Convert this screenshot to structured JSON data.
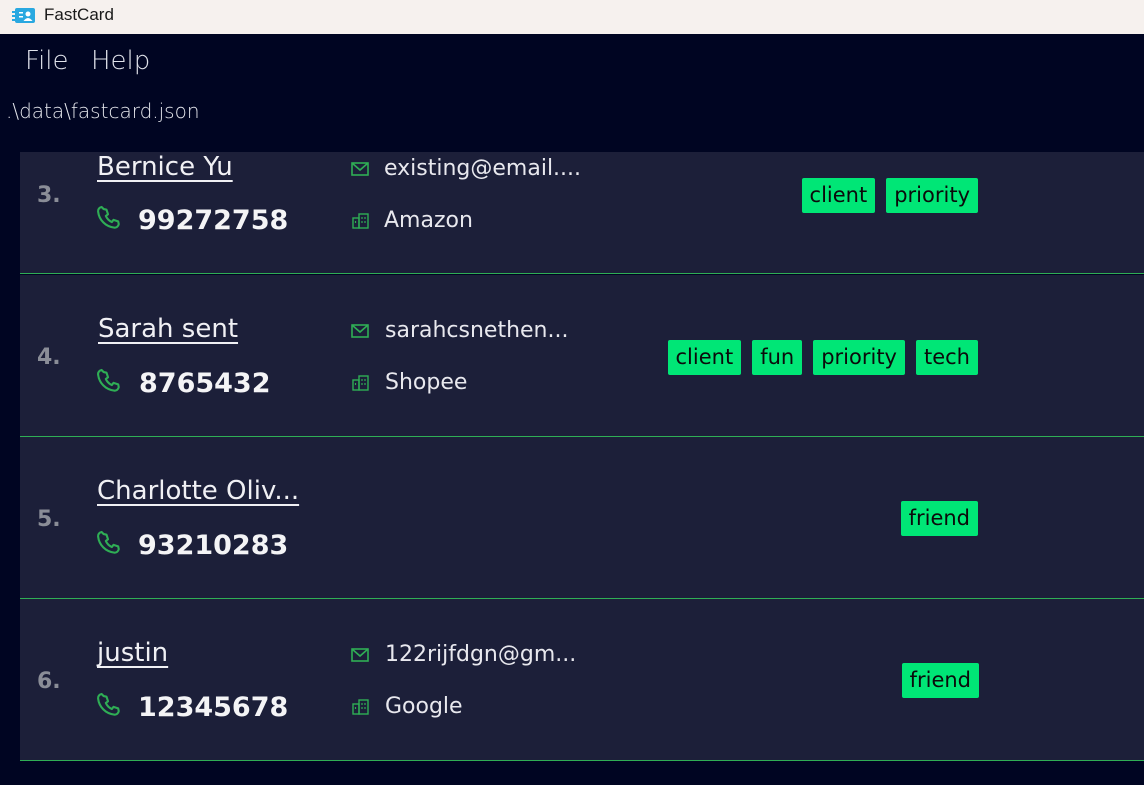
{
  "window": {
    "title": "FastCard",
    "icon": "contact-card-icon"
  },
  "menu": {
    "file": "File",
    "help": "Help"
  },
  "filepath": ".\\data\\fastcard.json",
  "colors": {
    "background": "#000522",
    "card": "#1c1f39",
    "tag": "#00e676",
    "icon_green": "#2fae55",
    "divider": "#2fae55"
  },
  "contacts": [
    {
      "index": "3.",
      "name": "Bernice Yu",
      "phone": "99272758",
      "email": "existing@email....",
      "company": "Amazon",
      "tags": [
        "client",
        "priority"
      ]
    },
    {
      "index": "4.",
      "name": "Sarah sent",
      "phone": "8765432",
      "email": "sarahcsnethen...",
      "company": "Shopee",
      "tags": [
        "client",
        "fun",
        "priority",
        "tech"
      ]
    },
    {
      "index": "5.",
      "name": "Charlotte Oliv...",
      "phone": "93210283",
      "email": "",
      "company": "",
      "tags": [
        "friend"
      ]
    },
    {
      "index": "6.",
      "name": "justin",
      "phone": "12345678",
      "email": "122rijfdgn@gm...",
      "company": "Google",
      "tags": [
        "friend"
      ]
    }
  ]
}
